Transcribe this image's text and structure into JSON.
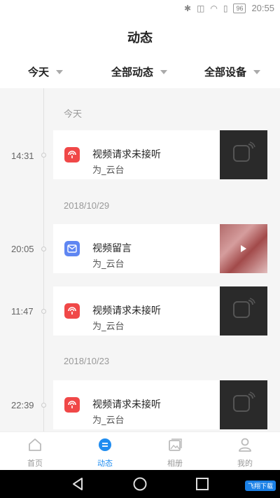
{
  "status": {
    "time": "20:55",
    "battery": "96"
  },
  "header": {
    "title": "动态"
  },
  "filters": [
    {
      "label": "今天"
    },
    {
      "label": "全部动态"
    },
    {
      "label": "全部设备"
    }
  ],
  "groups": [
    {
      "date": "今天",
      "items": [
        {
          "time": "14:31",
          "title": "视频请求未接听",
          "subtitle": "为_云台",
          "type": "missed-call"
        }
      ]
    },
    {
      "date": "2018/10/29",
      "items": [
        {
          "time": "20:05",
          "title": "视频留言",
          "subtitle": "为_云台",
          "type": "video-message"
        },
        {
          "time": "11:47",
          "title": "视频请求未接听",
          "subtitle": "为_云台",
          "type": "missed-call"
        }
      ]
    },
    {
      "date": "2018/10/23",
      "items": [
        {
          "time": "22:39",
          "title": "视频请求未接听",
          "subtitle": "为_云台",
          "type": "missed-call"
        }
      ]
    }
  ],
  "tabs": [
    {
      "label": "首页",
      "icon": "home-icon"
    },
    {
      "label": "动态",
      "icon": "activity-icon",
      "active": true
    },
    {
      "label": "相册",
      "icon": "album-icon"
    },
    {
      "label": "我的",
      "icon": "profile-icon"
    }
  ],
  "watermark": "飞翔下载",
  "colors": {
    "accent": "#1f8cf0",
    "missed": "#f04848",
    "message": "#5f86f2"
  }
}
